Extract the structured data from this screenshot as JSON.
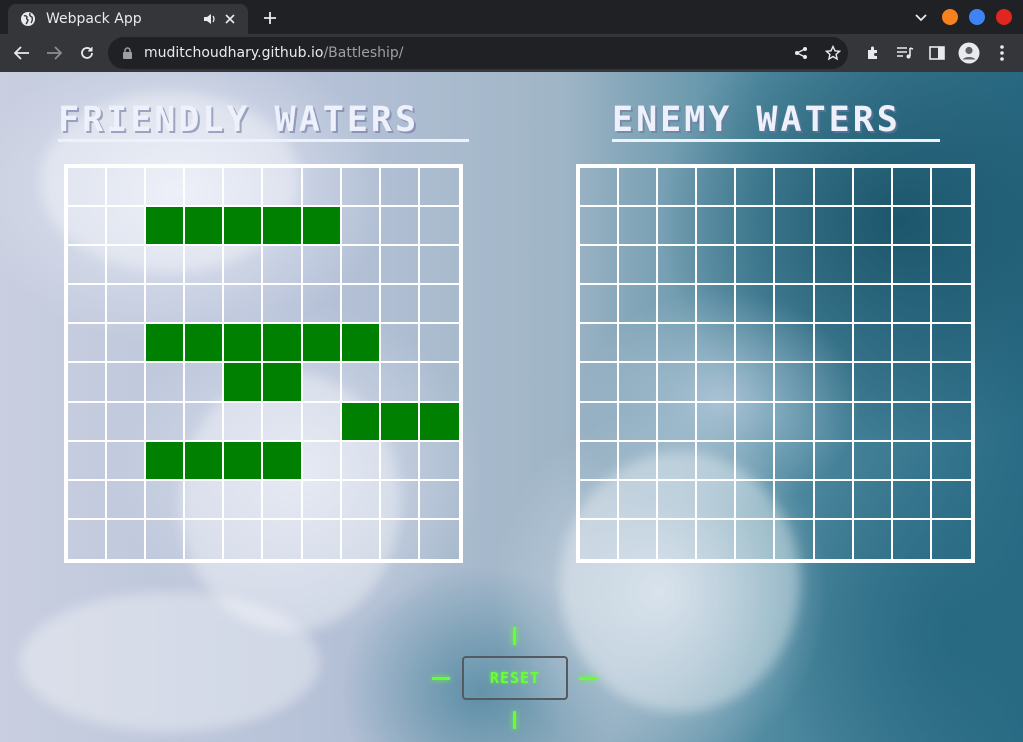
{
  "browser": {
    "tab": {
      "title": "Webpack App",
      "favicon": "globe-icon",
      "audio_icon": "speaker-icon",
      "close_icon": "close-icon"
    },
    "new_tab_icon": "plus-icon",
    "address_bar": {
      "url_host": "muditchoudhary.github.io",
      "url_path": "/Battleship/",
      "lock_icon": "lock-icon"
    },
    "nav": [
      "back-arrow-icon",
      "forward-arrow-icon",
      "reload-icon"
    ],
    "toolbar_icons": [
      "share-icon",
      "star-icon",
      "extensions-icon",
      "media-icon",
      "side-panel-icon",
      "profile-icon",
      "menu-icon"
    ],
    "window_controls": {
      "minimize": "#f5821f",
      "maximize": "#3d84f5",
      "close": "#e0261f"
    }
  },
  "page": {
    "friendly_title": "FRIENDLY WATERS",
    "enemy_title": "ENEMY WATERS",
    "reset_label": "RESET",
    "colors": {
      "ship": "#008000",
      "grid": "#ffffff",
      "reset_text": "#66ff33",
      "crosshair": "#66ff33"
    },
    "grid_size": 10,
    "friendly_board": {
      "ship_cells": [
        [
          1,
          2
        ],
        [
          1,
          3
        ],
        [
          1,
          4
        ],
        [
          1,
          5
        ],
        [
          1,
          6
        ],
        [
          4,
          2
        ],
        [
          4,
          3
        ],
        [
          4,
          4
        ],
        [
          4,
          5
        ],
        [
          4,
          6
        ],
        [
          4,
          7
        ],
        [
          5,
          4
        ],
        [
          5,
          5
        ],
        [
          6,
          7
        ],
        [
          6,
          8
        ],
        [
          6,
          9
        ],
        [
          7,
          2
        ],
        [
          7,
          3
        ],
        [
          7,
          4
        ],
        [
          7,
          5
        ]
      ]
    },
    "enemy_board": {
      "ship_cells": []
    }
  }
}
